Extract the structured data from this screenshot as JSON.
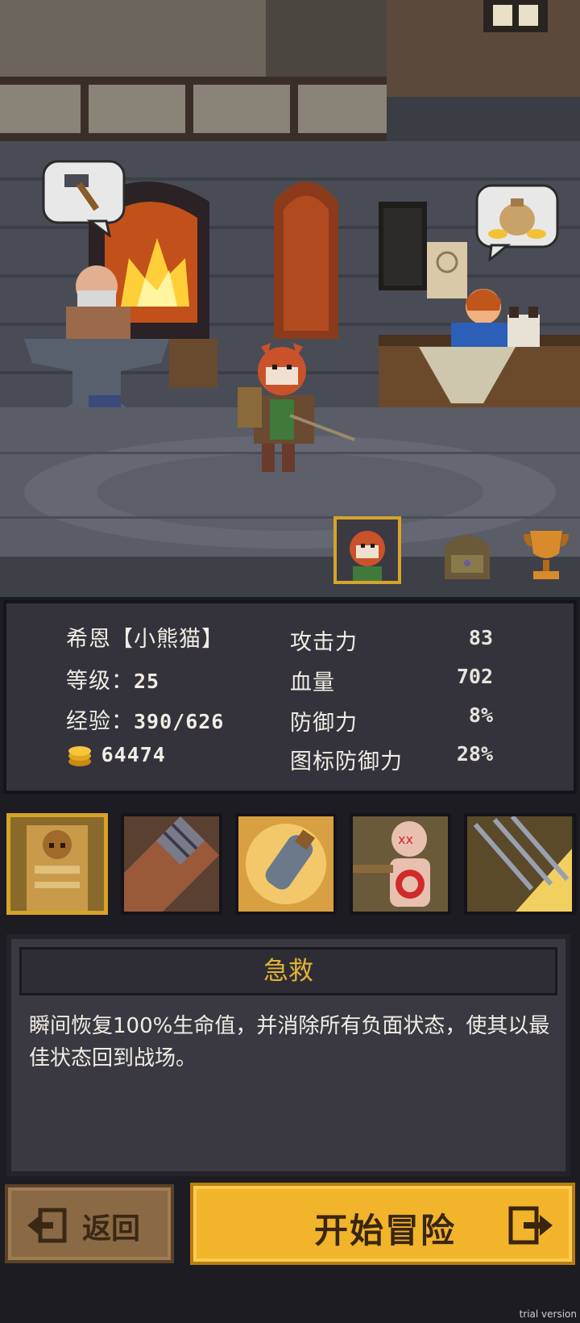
{
  "scene": {
    "bubbles": [
      {
        "icon": "hammer-icon"
      },
      {
        "icon": "money-bag-icon"
      }
    ],
    "tabs": [
      {
        "icon": "hero-portrait-icon",
        "active": true
      },
      {
        "icon": "backpack-icon",
        "active": false
      },
      {
        "icon": "trophy-icon",
        "active": false
      }
    ]
  },
  "stats": {
    "name": "希恩【小熊猫】",
    "level_label": "等级：",
    "level_value": "25",
    "exp_label": "经验：",
    "exp_value": "390/626",
    "gold_value": "64474",
    "attack_label": "攻击力",
    "attack_value": "83",
    "hp_label": "血量",
    "hp_value": "702",
    "defense_label": "防御力",
    "defense_value": "8%",
    "icon_defense_label": "图标防御力",
    "icon_defense_value": "28%"
  },
  "skills": [
    {
      "icon": "warrior-skill-icon",
      "active": true
    },
    {
      "icon": "spiked-block-skill-icon",
      "active": false
    },
    {
      "icon": "potion-bottle-skill-icon",
      "active": false
    },
    {
      "icon": "target-dummy-skill-icon",
      "active": false
    },
    {
      "icon": "arrow-volley-skill-icon",
      "active": false
    }
  ],
  "description": {
    "title": "急救",
    "text": "瞬间恢复100%生命值，并消除所有负面状态，使其以最佳状态回到战场。"
  },
  "buttons": {
    "back_label": "返回",
    "start_label": "开始冒险"
  },
  "watermark": "trial version",
  "colors": {
    "accent_gold": "#f2b42a",
    "panel_bg": "#34333c",
    "title_text": "#e3b235",
    "back_button": "#8a6a45"
  }
}
